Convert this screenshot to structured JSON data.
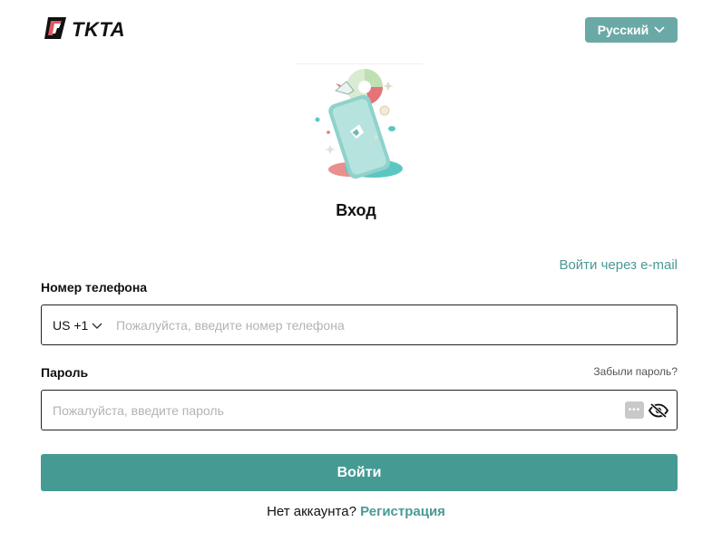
{
  "header": {
    "logo_text": "TKTA",
    "language_label": "Русский"
  },
  "main": {
    "title": "Вход",
    "email_login_link": "Войти через e-mail",
    "phone": {
      "label": "Номер телефона",
      "country_code": "US +1",
      "placeholder": "Пожалуйста, введите номер телефона",
      "value": ""
    },
    "password": {
      "label": "Пароль",
      "forgot_link": "Забыли пароль?",
      "placeholder": "Пожалуйста, введите пароль",
      "value": ""
    },
    "submit_label": "Войти",
    "signup": {
      "prompt": "Нет аккаунта?",
      "link": "Регистрация"
    }
  },
  "icons": {
    "logo": "tkta-logo-icon",
    "language_dropdown": "chevron-down-icon",
    "country_dropdown": "chevron-down-icon",
    "password_manager": "password-manager-icon",
    "toggle_visibility": "eye-slash-icon",
    "illustration": "phone-illustration"
  },
  "colors": {
    "accent": "#459a94",
    "language_button": "#6aa9a5",
    "link": "#4a9a94"
  }
}
